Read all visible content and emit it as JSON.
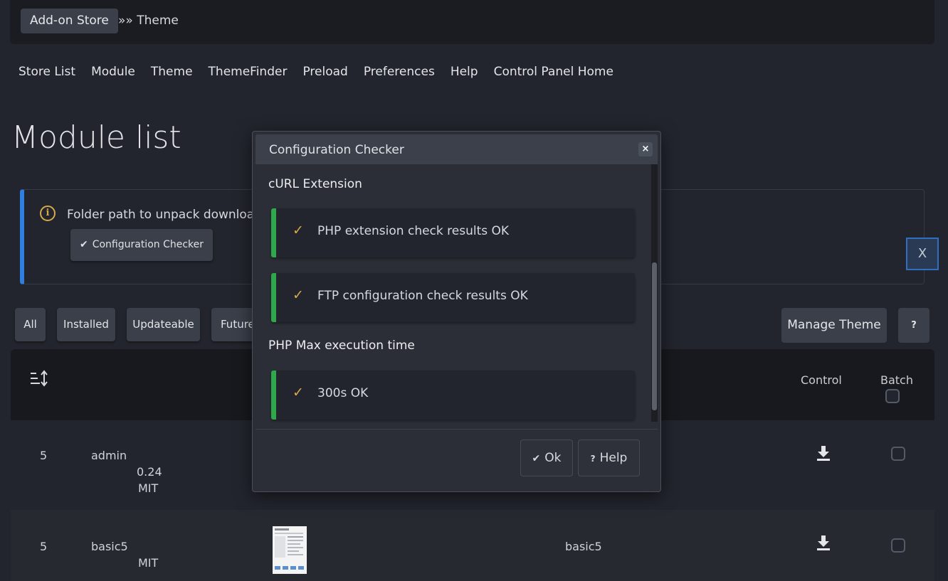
{
  "breadcrumb": {
    "store": "Add-on Store",
    "sep_current": "»» Theme"
  },
  "nav": [
    "Store List",
    "Module",
    "Theme",
    "ThemeFinder",
    "Preload",
    "Preferences",
    "Help",
    "Control Panel Home"
  ],
  "page_title": "Module list",
  "info": {
    "text": "Folder path to unpack download c",
    "button": "Configuration Checker",
    "close": "X"
  },
  "filters": [
    "All",
    "Installed",
    "Updateable",
    "Future"
  ],
  "actions": {
    "manage_theme": "Manage Theme",
    "help": "?"
  },
  "table": {
    "headers": {
      "control": "Control",
      "batch": "Batch"
    },
    "rows": [
      {
        "num": "5",
        "name": "admin",
        "version": "0.24",
        "license": "MIT",
        "theme": ""
      },
      {
        "num": "5",
        "name": "basic5",
        "version": "",
        "license": "MIT",
        "theme": "basic5"
      }
    ]
  },
  "modal": {
    "title": "Configuration Checker",
    "close": "×",
    "sections": [
      {
        "heading": "cURL Extension",
        "results": [
          "PHP extension check results OK",
          "FTP configuration check results OK"
        ]
      },
      {
        "heading": "PHP Max execution time",
        "results": [
          "300s OK"
        ]
      }
    ],
    "ok_label": "Ok",
    "help_label": "Help"
  },
  "colors": {
    "accent_blue": "#2f7fe0",
    "ok_green": "#2ea84a",
    "check_gold": "#d8a84b"
  }
}
